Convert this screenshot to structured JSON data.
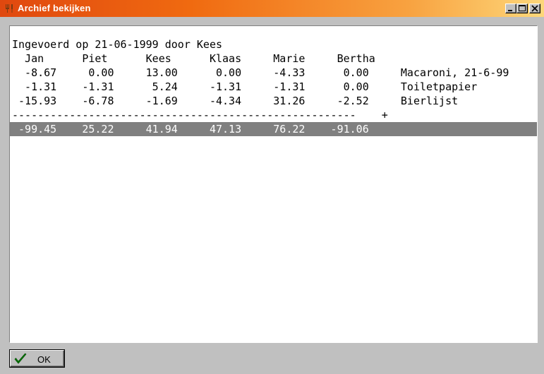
{
  "window": {
    "title": "Archief bekijken",
    "icon": "cutlery-icon",
    "controls": [
      "minimize-icon",
      "maximize-icon",
      "close-icon"
    ]
  },
  "report": {
    "header": "Ingevoerd op 21-06-1999 door Kees",
    "columns_line": "  Jan      Piet      Kees      Klaas     Marie     Bertha",
    "rows": [
      "  -8.67     0.00     13.00      0.00     -4.33      0.00     Macaroni, 21-6-99",
      "  -1.31    -1.31      5.24     -1.31     -1.31      0.00     Toiletpapier",
      " -15.93    -6.78     -1.69     -4.34     31.26     -2.52     Bierlijst"
    ],
    "separator": "------------------------------------------------------    +",
    "totals": " -99.45    25.22     41.94     47.13     76.22    -91.06"
  },
  "buttons": {
    "ok_label": "OK",
    "ok_icon": "checkmark-icon"
  },
  "colors": {
    "title_start": "#e0480f",
    "title_end": "#fdd77a",
    "highlight": "#808080",
    "checkmark": "#008000"
  }
}
